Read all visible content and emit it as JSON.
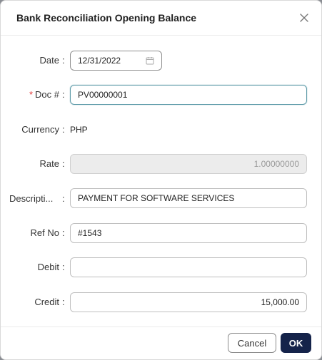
{
  "dialog": {
    "title": "Bank Reconciliation Opening Balance"
  },
  "form": {
    "date": {
      "label": "Date",
      "value": "12/31/2022"
    },
    "doc_no": {
      "label": "Doc #",
      "required_mark": "*",
      "value": "PV00000001"
    },
    "currency": {
      "label": "Currency",
      "value": "PHP"
    },
    "rate": {
      "label": "Rate",
      "value": "1.00000000"
    },
    "description": {
      "label": "Descripti...",
      "value": "PAYMENT FOR SOFTWARE SERVICES"
    },
    "ref_no": {
      "label": "Ref No",
      "value": "#1543"
    },
    "debit": {
      "label": "Debit",
      "value": ""
    },
    "credit": {
      "label": "Credit",
      "value": "15,000.00"
    },
    "colon": ":"
  },
  "footer": {
    "cancel_label": "Cancel",
    "ok_label": "OK"
  },
  "colors": {
    "primary": "#15234a",
    "focus_border": "#5d9aa8",
    "required": "#e23b3b"
  },
  "icons": {
    "close": "close-icon",
    "date": "calendar-icon"
  }
}
